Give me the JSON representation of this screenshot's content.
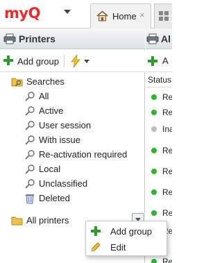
{
  "app": {
    "logo_text": "myQ"
  },
  "tabs": [
    {
      "label": "Home",
      "close_glyph": "×",
      "icon": "home-icon"
    }
  ],
  "left_panel": {
    "title": "Printers",
    "toolbar": {
      "add_group_label": "Add group",
      "action_icon": "lightning-icon"
    },
    "tree": {
      "searches_label": "Searches",
      "searches": [
        "All",
        "Active",
        "User session",
        "With issue",
        "Re-activation required",
        "Local",
        "Unclassified",
        "Deleted"
      ],
      "all_printers_label": "All printers"
    }
  },
  "right_panel": {
    "title_partial": "Al",
    "toolbar_partial": "A",
    "column_header": "Status",
    "rows": [
      {
        "text": "Re",
        "status": "green"
      },
      {
        "text": "Re",
        "status": "green"
      },
      {
        "text": "Ina",
        "status": "gray"
      },
      {
        "text": "Re",
        "status": "green"
      },
      {
        "text": "Re",
        "status": "green"
      },
      {
        "text": "Re",
        "status": "green"
      },
      {
        "text": "Re",
        "status": "green"
      },
      {
        "text": "Re",
        "status": "green"
      },
      {
        "text": "Re",
        "status": "green"
      }
    ]
  },
  "context_menu": {
    "items": [
      {
        "label": "Add group",
        "icon": "plus-icon"
      },
      {
        "label": "Edit",
        "icon": "pencil-icon"
      }
    ]
  },
  "colors": {
    "brand_red": "#ee2a2a",
    "status_green": "#2db52d",
    "status_gray": "#bdbdbd",
    "plus_green": "#2e9a2e",
    "folder_yellow": "#f0c24a"
  }
}
